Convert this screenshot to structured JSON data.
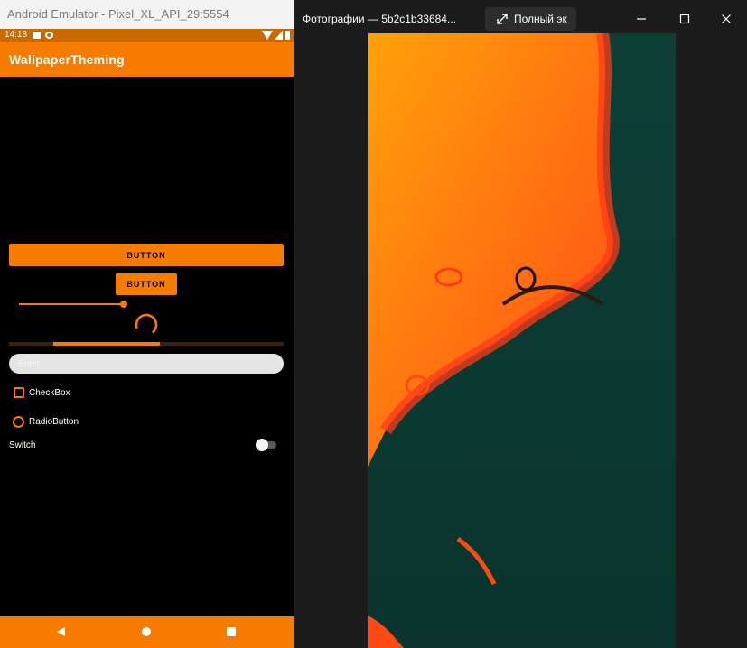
{
  "emulator": {
    "window_title": "Android Emulator - Pixel_XL_API_29:5554",
    "status_time": "14:18",
    "app_title": "WallpaperTheming",
    "button_wide_label": "BUTTON",
    "button_small_label": "BUTTON",
    "slider_value": 1.0,
    "progress_segment": [
      0.16,
      0.55
    ],
    "edittext_placeholder": "Enter",
    "checkbox_label": "CheckBox",
    "checkbox_checked": false,
    "radio_label": "RadioButton",
    "radio_checked": false,
    "switch_label": "Switch",
    "switch_on": false,
    "nav_icons": [
      "back-icon",
      "home-icon",
      "recents-icon"
    ]
  },
  "photos": {
    "window_title": "Фотографии — 5b2c1b33684...",
    "fullscreen_label": "Полный эк",
    "window_buttons": [
      "minimize-icon",
      "maximize-icon",
      "close-icon"
    ]
  },
  "colors": {
    "accent": "#f57c00",
    "wallpaper_teal": "#0f3f36",
    "wallpaper_orange": "#ff5a14"
  }
}
